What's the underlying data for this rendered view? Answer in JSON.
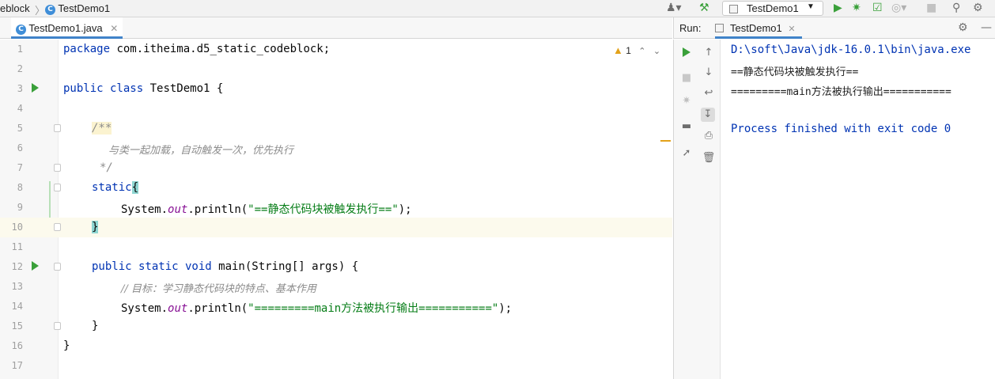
{
  "navbar": {
    "breadcrumb_package": "eblock",
    "breadcrumb_class": "TestDemo1",
    "class_icon": "C",
    "run_config": "TestDemo1",
    "icons": [
      "user-icon",
      "build-hammer-icon",
      "run-icon",
      "debug-icon",
      "coverage-icon",
      "profile-icon",
      "stop-icon",
      "search-icon",
      "settings-icon"
    ]
  },
  "editor": {
    "tab_label": "TestDemo1.java",
    "warning_count": "1",
    "line_numbers": [
      "1",
      "2",
      "3",
      "4",
      "5",
      "6",
      "7",
      "8",
      "9",
      "10",
      "11",
      "12",
      "13",
      "14",
      "15",
      "16",
      "17"
    ],
    "lines": {
      "l1_kw": "package",
      "l1_rest": " com.itheima.d5_static_codeblock;",
      "l3_kw": "public class",
      "l3_rest": " TestDemo1 {",
      "l5_doc": "/**",
      "l6_doc": "与类一起加载，自动触发一次，优先执行",
      "l7_doc": "*/",
      "l8_kw": "static",
      "l8_brace": "{",
      "l9_pre": "System.",
      "l9_field": "out",
      "l9_mid": ".println(",
      "l9_str": "\"==静态代码块被触发执行==\"",
      "l9_end": ");",
      "l10_brace": "}",
      "l12_kw": "public static void",
      "l12_rest": " main(String[] args) {",
      "l13_comment": "// 目标：学习静态代码块的特点、基本作用",
      "l14_pre": "System.",
      "l14_field": "out",
      "l14_mid": ".println(",
      "l14_str": "\"=========main方法被执行输出===========\"",
      "l14_end": ");",
      "l15": "}",
      "l16": "}"
    }
  },
  "run": {
    "label": "Run:",
    "tab_label": "TestDemo1",
    "console": [
      "D:\\soft\\Java\\jdk-16.0.1\\bin\\java.exe",
      "==静态代码块被触发执行==",
      "=========main方法被执行输出===========",
      "",
      "Process finished with exit code 0"
    ]
  },
  "colors": {
    "keyword": "#0033b3",
    "string": "#067d17",
    "comment": "#8c8c8c",
    "field": "#871094",
    "run_green": "#3aa03a",
    "tab_underline": "#4083c9"
  }
}
